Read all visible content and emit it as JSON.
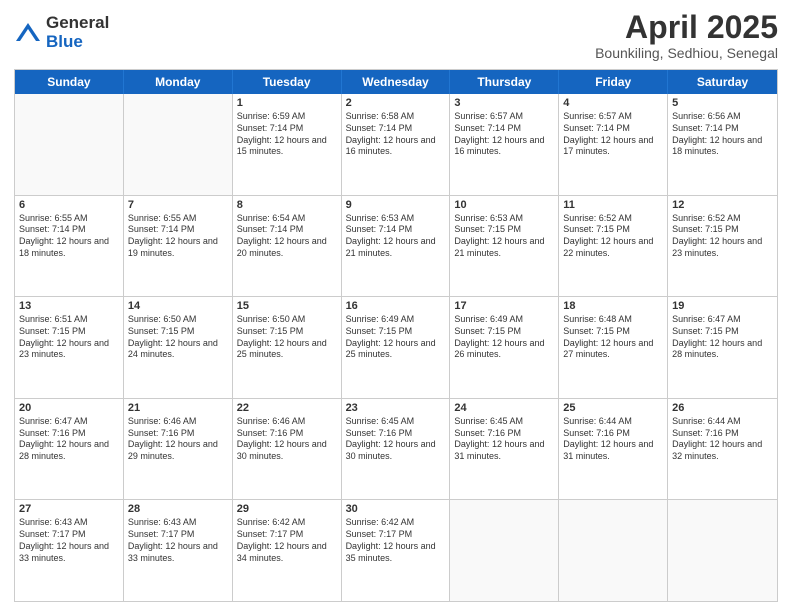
{
  "header": {
    "logo_general": "General",
    "logo_blue": "Blue",
    "month_title": "April 2025",
    "location": "Bounkiling, Sedhiou, Senegal"
  },
  "days_of_week": [
    "Sunday",
    "Monday",
    "Tuesday",
    "Wednesday",
    "Thursday",
    "Friday",
    "Saturday"
  ],
  "weeks": [
    [
      {
        "day": "",
        "info": ""
      },
      {
        "day": "",
        "info": ""
      },
      {
        "day": "1",
        "info": "Sunrise: 6:59 AM\nSunset: 7:14 PM\nDaylight: 12 hours and 15 minutes."
      },
      {
        "day": "2",
        "info": "Sunrise: 6:58 AM\nSunset: 7:14 PM\nDaylight: 12 hours and 16 minutes."
      },
      {
        "day": "3",
        "info": "Sunrise: 6:57 AM\nSunset: 7:14 PM\nDaylight: 12 hours and 16 minutes."
      },
      {
        "day": "4",
        "info": "Sunrise: 6:57 AM\nSunset: 7:14 PM\nDaylight: 12 hours and 17 minutes."
      },
      {
        "day": "5",
        "info": "Sunrise: 6:56 AM\nSunset: 7:14 PM\nDaylight: 12 hours and 18 minutes."
      }
    ],
    [
      {
        "day": "6",
        "info": "Sunrise: 6:55 AM\nSunset: 7:14 PM\nDaylight: 12 hours and 18 minutes."
      },
      {
        "day": "7",
        "info": "Sunrise: 6:55 AM\nSunset: 7:14 PM\nDaylight: 12 hours and 19 minutes."
      },
      {
        "day": "8",
        "info": "Sunrise: 6:54 AM\nSunset: 7:14 PM\nDaylight: 12 hours and 20 minutes."
      },
      {
        "day": "9",
        "info": "Sunrise: 6:53 AM\nSunset: 7:14 PM\nDaylight: 12 hours and 21 minutes."
      },
      {
        "day": "10",
        "info": "Sunrise: 6:53 AM\nSunset: 7:15 PM\nDaylight: 12 hours and 21 minutes."
      },
      {
        "day": "11",
        "info": "Sunrise: 6:52 AM\nSunset: 7:15 PM\nDaylight: 12 hours and 22 minutes."
      },
      {
        "day": "12",
        "info": "Sunrise: 6:52 AM\nSunset: 7:15 PM\nDaylight: 12 hours and 23 minutes."
      }
    ],
    [
      {
        "day": "13",
        "info": "Sunrise: 6:51 AM\nSunset: 7:15 PM\nDaylight: 12 hours and 23 minutes."
      },
      {
        "day": "14",
        "info": "Sunrise: 6:50 AM\nSunset: 7:15 PM\nDaylight: 12 hours and 24 minutes."
      },
      {
        "day": "15",
        "info": "Sunrise: 6:50 AM\nSunset: 7:15 PM\nDaylight: 12 hours and 25 minutes."
      },
      {
        "day": "16",
        "info": "Sunrise: 6:49 AM\nSunset: 7:15 PM\nDaylight: 12 hours and 25 minutes."
      },
      {
        "day": "17",
        "info": "Sunrise: 6:49 AM\nSunset: 7:15 PM\nDaylight: 12 hours and 26 minutes."
      },
      {
        "day": "18",
        "info": "Sunrise: 6:48 AM\nSunset: 7:15 PM\nDaylight: 12 hours and 27 minutes."
      },
      {
        "day": "19",
        "info": "Sunrise: 6:47 AM\nSunset: 7:15 PM\nDaylight: 12 hours and 28 minutes."
      }
    ],
    [
      {
        "day": "20",
        "info": "Sunrise: 6:47 AM\nSunset: 7:16 PM\nDaylight: 12 hours and 28 minutes."
      },
      {
        "day": "21",
        "info": "Sunrise: 6:46 AM\nSunset: 7:16 PM\nDaylight: 12 hours and 29 minutes."
      },
      {
        "day": "22",
        "info": "Sunrise: 6:46 AM\nSunset: 7:16 PM\nDaylight: 12 hours and 30 minutes."
      },
      {
        "day": "23",
        "info": "Sunrise: 6:45 AM\nSunset: 7:16 PM\nDaylight: 12 hours and 30 minutes."
      },
      {
        "day": "24",
        "info": "Sunrise: 6:45 AM\nSunset: 7:16 PM\nDaylight: 12 hours and 31 minutes."
      },
      {
        "day": "25",
        "info": "Sunrise: 6:44 AM\nSunset: 7:16 PM\nDaylight: 12 hours and 31 minutes."
      },
      {
        "day": "26",
        "info": "Sunrise: 6:44 AM\nSunset: 7:16 PM\nDaylight: 12 hours and 32 minutes."
      }
    ],
    [
      {
        "day": "27",
        "info": "Sunrise: 6:43 AM\nSunset: 7:17 PM\nDaylight: 12 hours and 33 minutes."
      },
      {
        "day": "28",
        "info": "Sunrise: 6:43 AM\nSunset: 7:17 PM\nDaylight: 12 hours and 33 minutes."
      },
      {
        "day": "29",
        "info": "Sunrise: 6:42 AM\nSunset: 7:17 PM\nDaylight: 12 hours and 34 minutes."
      },
      {
        "day": "30",
        "info": "Sunrise: 6:42 AM\nSunset: 7:17 PM\nDaylight: 12 hours and 35 minutes."
      },
      {
        "day": "",
        "info": ""
      },
      {
        "day": "",
        "info": ""
      },
      {
        "day": "",
        "info": ""
      }
    ]
  ]
}
